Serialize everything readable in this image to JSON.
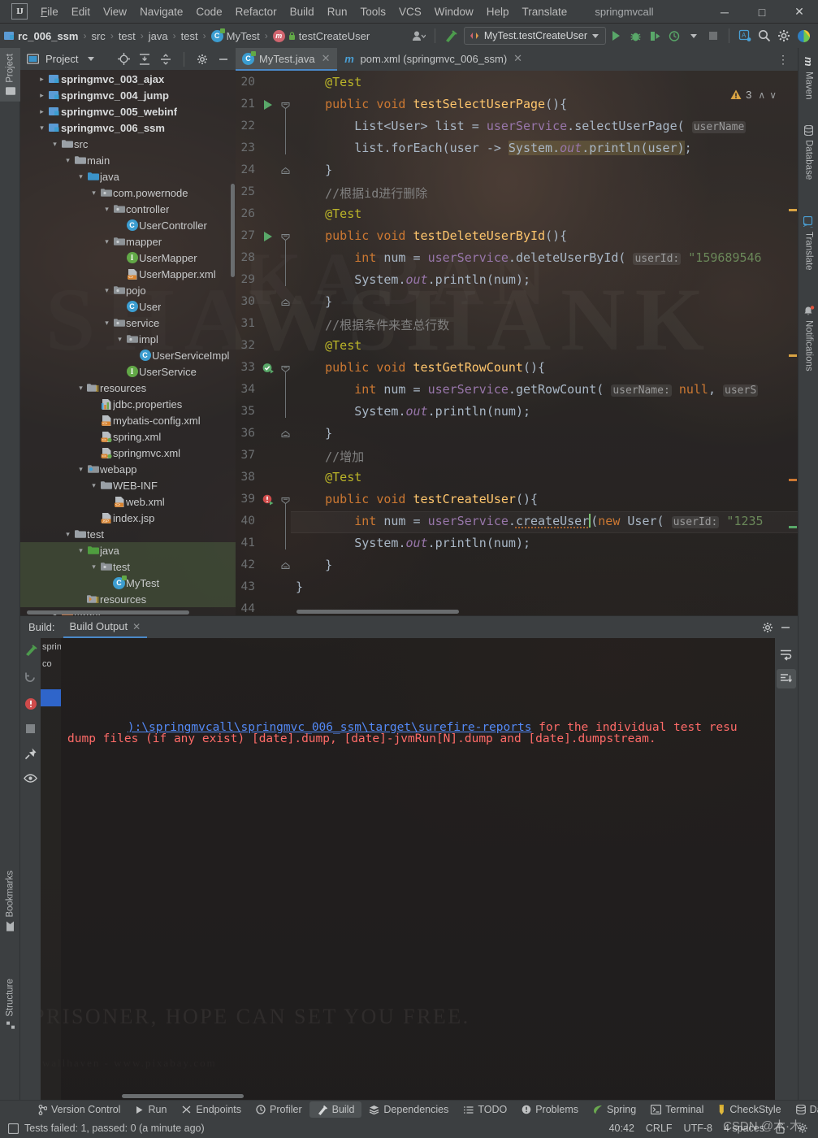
{
  "app": {
    "window_title": "springmvcall",
    "logo": "intellij-idea-logo"
  },
  "menu": {
    "items": [
      {
        "label": "File"
      },
      {
        "label": "Edit"
      },
      {
        "label": "View"
      },
      {
        "label": "Navigate"
      },
      {
        "label": "Code"
      },
      {
        "label": "Refactor"
      },
      {
        "label": "Build"
      },
      {
        "label": "Run"
      },
      {
        "label": "Tools"
      },
      {
        "label": "VCS"
      },
      {
        "label": "Window"
      },
      {
        "label": "Help"
      },
      {
        "label": "Translate"
      }
    ],
    "window_controls": {
      "minimize": "─",
      "maximize": "□",
      "close": "✕"
    }
  },
  "navbar": {
    "breadcrumbs": [
      {
        "label": "rc_006_ssm",
        "icon": "module-icon",
        "bold": true
      },
      {
        "label": "src",
        "icon": ""
      },
      {
        "label": "test",
        "icon": ""
      },
      {
        "label": "java",
        "icon": ""
      },
      {
        "label": "test",
        "icon": ""
      },
      {
        "label": "MyTest",
        "icon": "class-test-icon"
      },
      {
        "label": "testCreateUser",
        "icon": "method-icon"
      }
    ],
    "separator": "›",
    "run_config": "MyTest.testCreateUser",
    "buttons": [
      {
        "name": "user-profile-button",
        "icon": "person-icon"
      },
      {
        "name": "build-button",
        "icon": "hammer-icon"
      },
      {
        "name": "run-button",
        "icon": "play-icon"
      },
      {
        "name": "debug-button",
        "icon": "bug-icon"
      },
      {
        "name": "run-with-coverage-button",
        "icon": "coverage-icon"
      },
      {
        "name": "profile-button",
        "icon": "profiler-icon"
      },
      {
        "name": "stop-button",
        "icon": "stop-icon"
      },
      {
        "name": "updates-button",
        "icon": "ide-update-icon"
      },
      {
        "name": "search-everywhere-button",
        "icon": "search-icon"
      },
      {
        "name": "settings-button",
        "icon": "gear-icon"
      },
      {
        "name": "account-button",
        "icon": "avatar-icon"
      }
    ]
  },
  "left_stripe": {
    "tabs": [
      {
        "label": "Project",
        "icon": "project-folder-icon",
        "selected": true
      },
      {
        "label": "Bookmarks",
        "icon": "bookmark-icon",
        "selected": false
      },
      {
        "label": "Structure",
        "icon": "structure-icon",
        "selected": false
      }
    ]
  },
  "right_stripe": {
    "tabs": [
      {
        "label": "Maven",
        "icon": "maven-icon"
      },
      {
        "label": "Database",
        "icon": "database-icon"
      },
      {
        "label": "Translate",
        "icon": "translate-icon"
      },
      {
        "label": "Notifications",
        "icon": "bell-icon"
      }
    ]
  },
  "project_panel": {
    "title": "Project",
    "toolbar": [
      {
        "name": "select-opened-file-button",
        "icon": "crosshair-icon"
      },
      {
        "name": "expand-all-button",
        "icon": "expand-all-icon"
      },
      {
        "name": "collapse-all-button",
        "icon": "collapse-all-icon"
      },
      {
        "name": "panel-settings-button",
        "icon": "gear-icon"
      },
      {
        "name": "hide-panel-button",
        "icon": "minus-icon"
      }
    ],
    "tree": [
      {
        "label": "springmvc_003_ajax",
        "indent": 1,
        "arrow": "›",
        "icon": "module-icon",
        "bold": true,
        "highlight": false
      },
      {
        "label": "springmvc_004_jump",
        "indent": 1,
        "arrow": "›",
        "icon": "module-icon",
        "bold": true,
        "highlight": false
      },
      {
        "label": "springmvc_005_webinf",
        "indent": 1,
        "arrow": "›",
        "icon": "module-icon",
        "bold": true,
        "highlight": false
      },
      {
        "label": "springmvc_006_ssm",
        "indent": 1,
        "arrow": "⌄",
        "icon": "module-icon",
        "bold": true,
        "highlight": false
      },
      {
        "label": "src",
        "indent": 2,
        "arrow": "⌄",
        "icon": "folder-gray-icon",
        "bold": false,
        "highlight": false
      },
      {
        "label": "main",
        "indent": 3,
        "arrow": "⌄",
        "icon": "folder-gray-icon",
        "bold": false,
        "highlight": false
      },
      {
        "label": "java",
        "indent": 4,
        "arrow": "⌄",
        "icon": "folder-source-icon",
        "bold": false,
        "highlight": false
      },
      {
        "label": "com.powernode",
        "indent": 5,
        "arrow": "⌄",
        "icon": "package-icon",
        "bold": false,
        "highlight": false
      },
      {
        "label": "controller",
        "indent": 6,
        "arrow": "⌄",
        "icon": "package-icon",
        "bold": false,
        "highlight": false
      },
      {
        "label": "UserController",
        "indent": 7,
        "arrow": "",
        "icon": "class-icon",
        "bold": false,
        "highlight": false
      },
      {
        "label": "mapper",
        "indent": 6,
        "arrow": "⌄",
        "icon": "package-icon",
        "bold": false,
        "highlight": false
      },
      {
        "label": "UserMapper",
        "indent": 7,
        "arrow": "",
        "icon": "interface-icon",
        "bold": false,
        "highlight": false
      },
      {
        "label": "UserMapper.xml",
        "indent": 7,
        "arrow": "",
        "icon": "xml-icon",
        "bold": false,
        "highlight": false
      },
      {
        "label": "pojo",
        "indent": 6,
        "arrow": "⌄",
        "icon": "package-icon",
        "bold": false,
        "highlight": false
      },
      {
        "label": "User",
        "indent": 7,
        "arrow": "",
        "icon": "class-icon",
        "bold": false,
        "highlight": false
      },
      {
        "label": "service",
        "indent": 6,
        "arrow": "⌄",
        "icon": "package-icon",
        "bold": false,
        "highlight": false
      },
      {
        "label": "impl",
        "indent": 7,
        "arrow": "⌄",
        "icon": "package-icon",
        "bold": false,
        "highlight": false
      },
      {
        "label": "UserServiceImpl",
        "indent": 8,
        "arrow": "",
        "icon": "class-icon",
        "bold": false,
        "highlight": false
      },
      {
        "label": "UserService",
        "indent": 7,
        "arrow": "",
        "icon": "interface-icon",
        "bold": false,
        "highlight": false
      },
      {
        "label": "resources",
        "indent": 4,
        "arrow": "⌄",
        "icon": "folder-resources-icon",
        "bold": false,
        "highlight": false
      },
      {
        "label": "jdbc.properties",
        "indent": 5,
        "arrow": "",
        "icon": "properties-icon",
        "bold": false,
        "highlight": false
      },
      {
        "label": "mybatis-config.xml",
        "indent": 5,
        "arrow": "",
        "icon": "xml-icon",
        "bold": false,
        "highlight": false
      },
      {
        "label": "spring.xml",
        "indent": 5,
        "arrow": "",
        "icon": "xml-spring-icon",
        "bold": false,
        "highlight": false
      },
      {
        "label": "springmvc.xml",
        "indent": 5,
        "arrow": "",
        "icon": "xml-spring-icon",
        "bold": false,
        "highlight": false
      },
      {
        "label": "webapp",
        "indent": 4,
        "arrow": "⌄",
        "icon": "folder-webapp-icon",
        "bold": false,
        "highlight": false
      },
      {
        "label": "WEB-INF",
        "indent": 5,
        "arrow": "⌄",
        "icon": "folder-gray-icon",
        "bold": false,
        "highlight": false
      },
      {
        "label": "web.xml",
        "indent": 6,
        "arrow": "",
        "icon": "xml-icon",
        "bold": false,
        "highlight": false
      },
      {
        "label": "index.jsp",
        "indent": 5,
        "arrow": "",
        "icon": "jsp-icon",
        "bold": false,
        "highlight": false
      },
      {
        "label": "test",
        "indent": 3,
        "arrow": "⌄",
        "icon": "folder-gray-icon",
        "bold": false,
        "highlight": false
      },
      {
        "label": "java",
        "indent": 4,
        "arrow": "⌄",
        "icon": "folder-test-source-icon",
        "bold": false,
        "highlight": true
      },
      {
        "label": "test",
        "indent": 5,
        "arrow": "⌄",
        "icon": "package-icon",
        "bold": false,
        "highlight": true
      },
      {
        "label": "MyTest",
        "indent": 6,
        "arrow": "",
        "icon": "class-test-icon",
        "bold": false,
        "highlight": true
      },
      {
        "label": "resources",
        "indent": 4,
        "arrow": "",
        "icon": "folder-test-resources-icon",
        "bold": false,
        "highlight": true
      },
      {
        "label": "target",
        "indent": 2,
        "arrow": "⌄",
        "icon": "folder-excluded-icon",
        "bold": false,
        "highlight": false
      }
    ]
  },
  "editor": {
    "tabs": [
      {
        "label": "MyTest.java",
        "icon": "class-test-icon",
        "active": true,
        "close": "✕"
      },
      {
        "label": "pom.xml (springmvc_006_ssm)",
        "icon": "maven-icon",
        "active": false,
        "close": "✕"
      }
    ],
    "more_button": "⋮",
    "inspection": {
      "warning_icon": "warning-triangle-icon",
      "count": "3",
      "up": "∧",
      "down": "∨"
    },
    "first_line_number": 20,
    "lines": [
      {
        "n": 20,
        "text": "    @Test",
        "gutter": "",
        "fold": ""
      },
      {
        "n": 21,
        "text": "    public void testSelectUserPage(){",
        "gutter": "run-green",
        "fold": "open"
      },
      {
        "n": 22,
        "text": "        List<User> list = userService.selectUserPage( userName",
        "gutter": "",
        "fold": ""
      },
      {
        "n": 23,
        "text": "        list.forEach(user -> System.out.println(user));",
        "gutter": "",
        "fold": ""
      },
      {
        "n": 24,
        "text": "    }",
        "gutter": "",
        "fold": "close"
      },
      {
        "n": 25,
        "text": "    //根据id进行删除",
        "gutter": "",
        "fold": ""
      },
      {
        "n": 26,
        "text": "    @Test",
        "gutter": "",
        "fold": ""
      },
      {
        "n": 27,
        "text": "    public void testDeleteUserById(){",
        "gutter": "run-green",
        "fold": "open"
      },
      {
        "n": 28,
        "text": "        int num = userService.deleteUserById( userId: \"159689546",
        "gutter": "",
        "fold": ""
      },
      {
        "n": 29,
        "text": "        System.out.println(num);",
        "gutter": "",
        "fold": ""
      },
      {
        "n": 30,
        "text": "    }",
        "gutter": "",
        "fold": "close"
      },
      {
        "n": 31,
        "text": "    //根据条件来查总行数",
        "gutter": "",
        "fold": ""
      },
      {
        "n": 32,
        "text": "    @Test",
        "gutter": "",
        "fold": ""
      },
      {
        "n": 33,
        "text": "    public void testGetRowCount(){",
        "gutter": "run-passed",
        "fold": "open"
      },
      {
        "n": 34,
        "text": "        int num = userService.getRowCount( userName: null, userS",
        "gutter": "",
        "fold": ""
      },
      {
        "n": 35,
        "text": "        System.out.println(num);",
        "gutter": "",
        "fold": ""
      },
      {
        "n": 36,
        "text": "    }",
        "gutter": "",
        "fold": "close"
      },
      {
        "n": 37,
        "text": "    //增加",
        "gutter": "",
        "fold": ""
      },
      {
        "n": 38,
        "text": "    @Test",
        "gutter": "",
        "fold": ""
      },
      {
        "n": 39,
        "text": "    public void testCreateUser(){",
        "gutter": "run-failed",
        "fold": "open"
      },
      {
        "n": 40,
        "text": "        int num = userService.createUser(new User( userId: \"1235",
        "gutter": "",
        "fold": ""
      },
      {
        "n": 41,
        "text": "        System.out.println(num);",
        "gutter": "",
        "fold": ""
      },
      {
        "n": 42,
        "text": "    }",
        "gutter": "",
        "fold": "close"
      },
      {
        "n": 43,
        "text": "}",
        "gutter": "",
        "fold": ""
      },
      {
        "n": 44,
        "text": "",
        "gutter": "",
        "fold": ""
      }
    ],
    "caret_line": 40
  },
  "build_panel": {
    "label": "Build:",
    "tab": {
      "label": "Build Output",
      "close": "✕"
    },
    "toolbar": [
      {
        "name": "build-project-button",
        "icon": "hammer-icon"
      },
      {
        "name": "rerun-build-button",
        "icon": "rerun-icon"
      },
      {
        "name": "filter-errors-button",
        "icon": "error-circle-icon"
      },
      {
        "name": "stop-build-button",
        "icon": "stop-icon"
      },
      {
        "name": "pin-tab-button",
        "icon": "pin-icon"
      },
      {
        "name": "show-ignored-button",
        "icon": "eye-icon"
      }
    ],
    "right_tools": [
      {
        "name": "soft-wrap-button",
        "icon": "soft-wrap-icon"
      },
      {
        "name": "scroll-to-end-button",
        "icon": "scroll-to-end-icon"
      }
    ],
    "tree_rows": [
      {
        "label": "sprin",
        "selected": false
      },
      {
        "label": "co",
        "selected": false
      },
      {
        "label": "",
        "selected": false
      },
      {
        "label": "",
        "selected": true
      }
    ],
    "console": [
      {
        "link": "):\\springmvcall\\springmvc_006_ssm\\target\\surefire-reports",
        "rest": " for the individual test resu"
      },
      {
        "link": "",
        "rest": "dump files (if any exist) [date].dump, [date]-jvmRun[N].dump and [date].dumpstream."
      }
    ]
  },
  "tool_tabs": [
    {
      "label": "Version Control",
      "icon": "branch-icon",
      "selected": false
    },
    {
      "label": "Run",
      "icon": "play-icon",
      "selected": false
    },
    {
      "label": "Endpoints",
      "icon": "endpoints-icon",
      "selected": false
    },
    {
      "label": "Profiler",
      "icon": "profiler-icon",
      "selected": false
    },
    {
      "label": "Build",
      "icon": "hammer-icon",
      "selected": true
    },
    {
      "label": "Dependencies",
      "icon": "dependencies-icon",
      "selected": false
    },
    {
      "label": "TODO",
      "icon": "todo-icon",
      "selected": false
    },
    {
      "label": "Problems",
      "icon": "problems-icon",
      "selected": false
    },
    {
      "label": "Spring",
      "icon": "spring-leaf-icon",
      "selected": false
    },
    {
      "label": "Terminal",
      "icon": "terminal-icon",
      "selected": false
    },
    {
      "label": "CheckStyle",
      "icon": "checkstyle-icon",
      "selected": false
    },
    {
      "label": "Da",
      "icon": "database-icon",
      "selected": false
    }
  ],
  "statusbar": {
    "message_icon": "tests-icon",
    "message": "Tests failed: 1, passed: 0 (a minute ago)",
    "caret_position": "40:42",
    "line_separator": "CRLF",
    "encoding": "UTF-8",
    "indent": "4 spaces",
    "lock_icon": "unlocked-icon",
    "inspection_icon": "inspection-gear-icon"
  },
  "wallpaper": {
    "quote": "PRISONER, HOPE CAN SET YOU FREE.",
    "sub": "wallhaven - www.pixabay.com",
    "big1": "SHAWSHANK",
    "big2": "KABAN"
  },
  "watermark": "CSDN @木·木",
  "colors": {
    "accent_blue": "#4a88c7",
    "panel_bg": "#3c3f41",
    "editor_text": "#a9b7c6",
    "keyword": "#cc7832",
    "string": "#6a8759",
    "method": "#ffc66d",
    "field": "#9876aa",
    "annotation": "#bbb529",
    "comment": "#808080",
    "error_red": "#ff6b68",
    "link_blue": "#548af7",
    "run_green": "#499c54",
    "warning_yellow": "#d9a343"
  }
}
